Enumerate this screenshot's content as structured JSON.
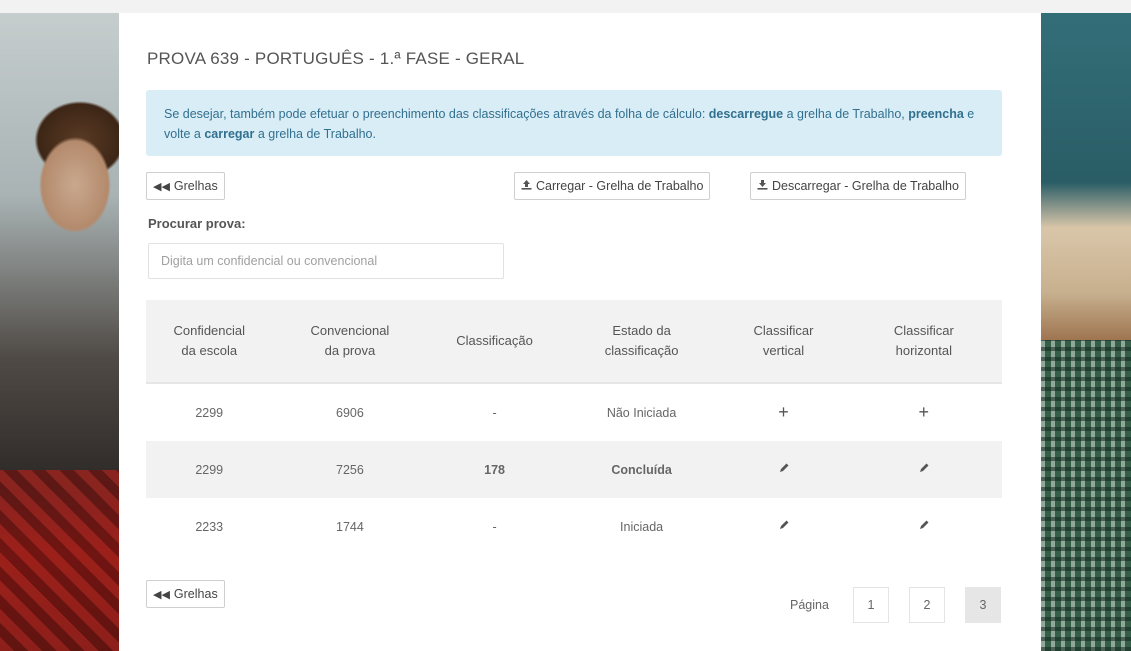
{
  "title": "PROVA 639 - PORTUGUÊS - 1.ª FASE - GERAL",
  "info": {
    "p1": "Se desejar, também pode efetuar o preenchimento das classificações através da folha de cálculo: ",
    "b1": "descarregue",
    "p2": " a grelha de Trabalho, ",
    "b2": "preencha",
    "p3": " e volte a ",
    "b3": "carregar",
    "p4": " a grelha de Trabalho."
  },
  "buttons": {
    "grelhas": "Grelhas",
    "carregar": "Carregar - Grelha de Trabalho",
    "descarregar": "Descarregar - Grelha de Trabalho"
  },
  "search": {
    "label": "Procurar prova:",
    "placeholder": "Digita um confidencial ou convencional"
  },
  "table": {
    "headers": {
      "c1a": "Confidencial",
      "c1b": "da escola",
      "c2a": "Convencional",
      "c2b": "da prova",
      "c3": "Classificação",
      "c4a": "Estado da",
      "c4b": "classificação",
      "c5a": "Classificar",
      "c5b": "vertical",
      "c6a": "Classificar",
      "c6b": "horizontal"
    },
    "rows": [
      {
        "escola": "2299",
        "prova": "6906",
        "classificacao": "-",
        "estado": "Não Iniciada",
        "vertical_icon": "plus-icon",
        "horizontal_icon": "plus-icon"
      },
      {
        "escola": "2299",
        "prova": "7256",
        "classificacao": "178",
        "estado": "Concluída",
        "vertical_icon": "pencil-icon",
        "horizontal_icon": "pencil-icon"
      },
      {
        "escola": "2233",
        "prova": "1744",
        "classificacao": "-",
        "estado": "Iniciada",
        "vertical_icon": "pencil-icon",
        "horizontal_icon": "pencil-icon"
      }
    ]
  },
  "pagination": {
    "label": "Página",
    "pages": [
      "1",
      "2",
      "3"
    ],
    "current": "3"
  },
  "colors": {
    "info_bg": "#d9edf7",
    "info_text": "#31708f",
    "status_done": "#3a9d3a"
  }
}
